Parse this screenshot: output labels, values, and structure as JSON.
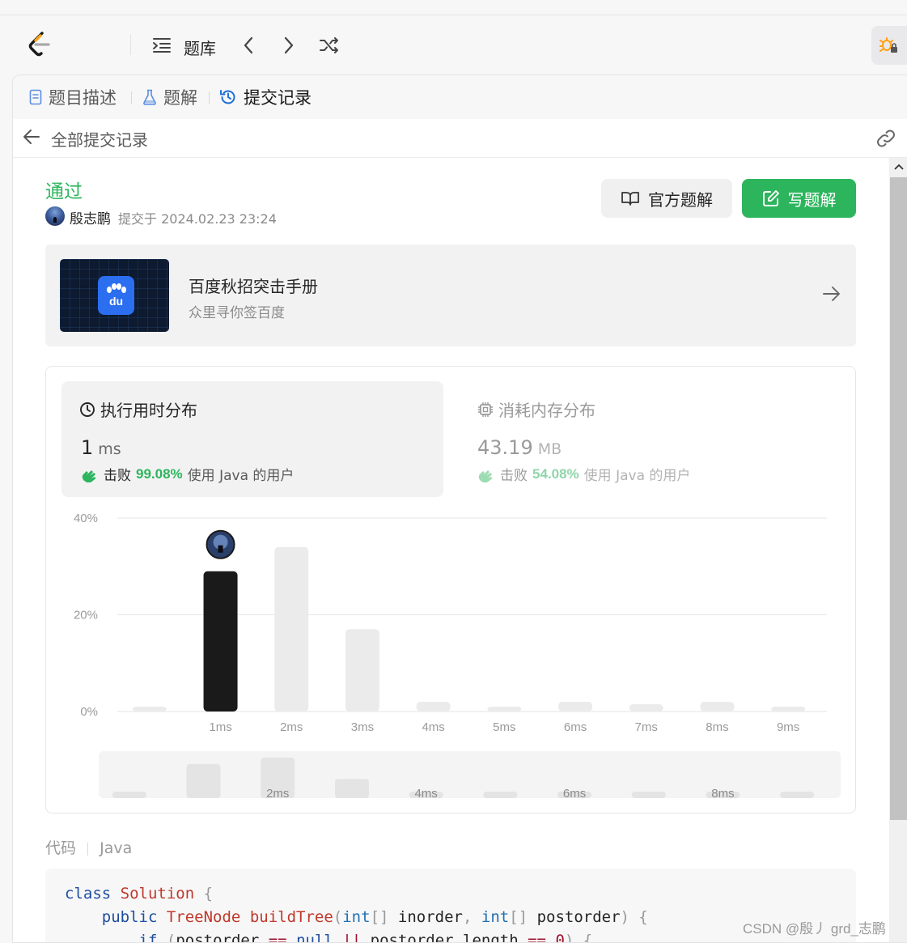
{
  "topbar": {
    "library_label": "题库"
  },
  "tabs": [
    {
      "label": "题目描述"
    },
    {
      "label": "题解"
    },
    {
      "label": "提交记录"
    }
  ],
  "subheader": {
    "title": "全部提交记录"
  },
  "submission": {
    "status": "通过",
    "author": "殷志鹏",
    "submitted_at": "提交于 2024.02.23 23:24",
    "buttons": {
      "official_solution": "官方题解",
      "write_solution": "写题解"
    }
  },
  "ad": {
    "title": "百度秋招突击手册",
    "subtitle": "众里寻你签百度",
    "logo_text": "du"
  },
  "runtime": {
    "title": "执行用时分布",
    "value": "1",
    "unit": "ms",
    "beat_prefix": "击败",
    "beat_percent": "99.08%",
    "beat_suffix": "使用 Java 的用户"
  },
  "memory": {
    "title": "消耗内存分布",
    "value": "43.19",
    "unit": "MB",
    "beat_prefix": "击败",
    "beat_percent": "54.08%",
    "beat_suffix": "使用 Java 的用户"
  },
  "chart_data": {
    "type": "bar",
    "categories": [
      "",
      "1ms",
      "2ms",
      "3ms",
      "4ms",
      "5ms",
      "6ms",
      "7ms",
      "8ms",
      "9ms"
    ],
    "values": [
      1,
      29,
      34,
      17,
      2,
      1,
      2,
      1.5,
      2,
      1
    ],
    "highlight_index": 1,
    "ylim": [
      0,
      40
    ],
    "yticks": [
      "0%",
      "20%",
      "40%"
    ],
    "ytick_values": [
      0,
      20,
      40
    ],
    "grid": true,
    "colors": {
      "highlight": "#1a1a1a",
      "bar": "#ebebeb"
    },
    "navigator": {
      "values": [
        2,
        16,
        19,
        9,
        2,
        2,
        2,
        2,
        2,
        2
      ],
      "labels": [
        "",
        "",
        "2ms",
        "",
        "4ms",
        "",
        "6ms",
        "",
        "8ms",
        ""
      ]
    }
  },
  "code": {
    "label": "代码",
    "language": "Java"
  },
  "watermark": "CSDN @殷丿 grd_志鹏",
  "colors": {
    "accent_green": "#2db55d",
    "active_tab_icon": "#1f6fd9"
  }
}
